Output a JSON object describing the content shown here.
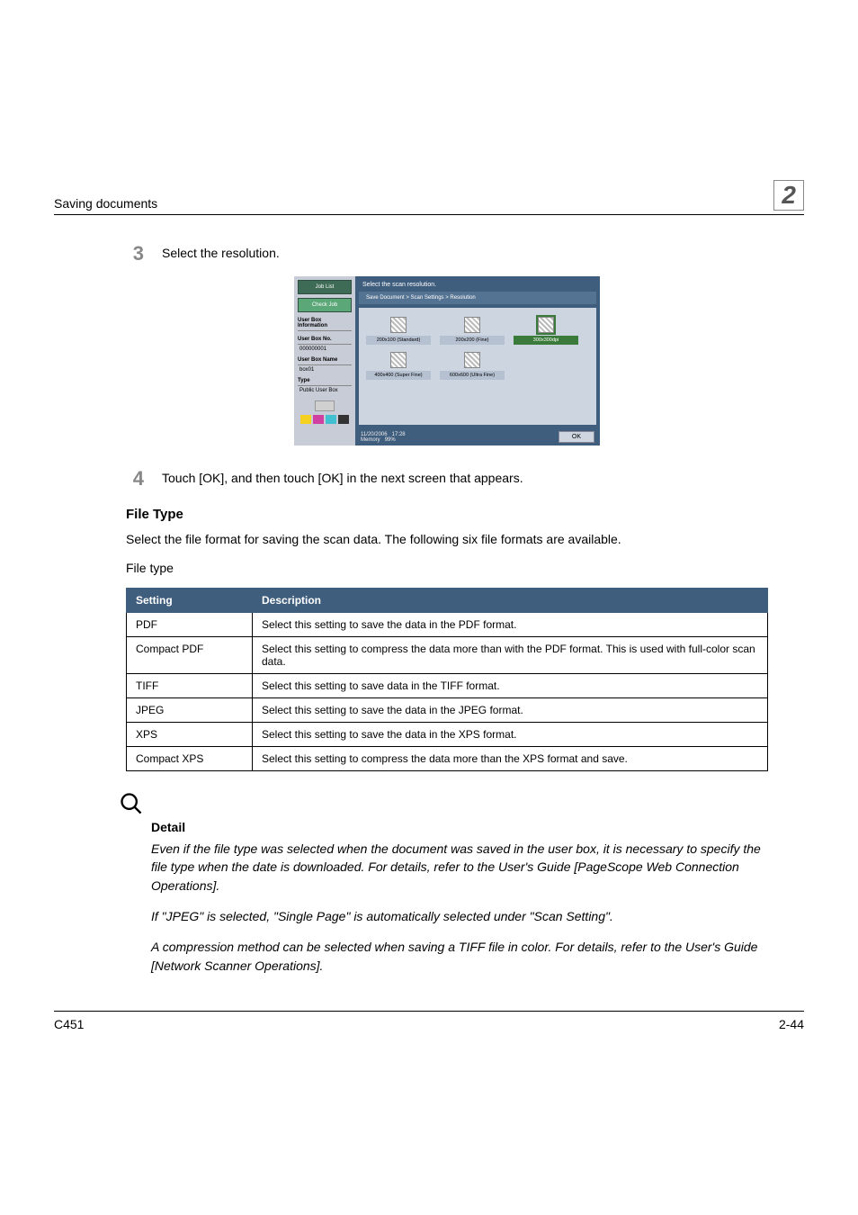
{
  "header": {
    "left": "Saving documents",
    "right": "2"
  },
  "steps": {
    "s3": {
      "num": "3",
      "text": "Select the resolution."
    },
    "s4": {
      "num": "4",
      "text": "Touch [OK], and then touch [OK] in the next screen that appears."
    }
  },
  "screenshot": {
    "sidebar": {
      "jobList": "Job List",
      "checkJob": "Check Job",
      "userBoxInfo": "User Box\nInformation",
      "userBoxNoLabel": "User Box No.",
      "userBoxNoValue": "000000001",
      "userBoxNameLabel": "User Box Name",
      "userBoxNameValue": "box01",
      "typeLabel": "Type",
      "typeValue": "Public\nUser Box"
    },
    "title": "Select the scan resolution.",
    "breadcrumb": "Save Document > Scan Settings > Resolution",
    "options": {
      "o1": "200x100 (Standard)",
      "o2": "200x200 (Fine)",
      "o3": "300x300dpi",
      "o4": "400x400\n(Super Fine)",
      "o5": "600x600\n(Ultra Fine)"
    },
    "footer": {
      "date": "11/20/2006",
      "time": "17:28",
      "memLabel": "Memory",
      "memValue": "99%",
      "ok": "OK"
    }
  },
  "fileTypeSection": {
    "heading": "File Type",
    "intro": "Select the file format for saving the scan data. The following six file formats are available.",
    "caption": "File type",
    "th1": "Setting",
    "th2": "Description",
    "rows": {
      "r0": {
        "name": "PDF",
        "desc": "Select this setting to save the data in the PDF format."
      },
      "r1": {
        "name": "Compact PDF",
        "desc": "Select this setting to compress the data more than with the PDF format. This is used with full-color scan data."
      },
      "r2": {
        "name": "TIFF",
        "desc": "Select this setting to save data in the TIFF format."
      },
      "r3": {
        "name": "JPEG",
        "desc": "Select this setting to save the data in the JPEG format."
      },
      "r4": {
        "name": "XPS",
        "desc": "Select this setting to save the data in the XPS format."
      },
      "r5": {
        "name": "Compact XPS",
        "desc": "Select this setting to compress the data more than the XPS format and save."
      }
    }
  },
  "detail": {
    "heading": "Detail",
    "p1": "Even if the file type was selected when the document was saved in the user box, it is necessary to specify the file type when the date is downloaded. For details, refer to the User's Guide [PageScope Web Connection Operations].",
    "p2": "If \"JPEG\" is selected, \"Single Page\" is automatically selected under \"Scan Setting\".",
    "p3": "A compression method can be selected when saving a TIFF file in color. For details, refer to the User's Guide [Network Scanner Operations]."
  },
  "footer": {
    "left": "C451",
    "right": "2-44"
  }
}
